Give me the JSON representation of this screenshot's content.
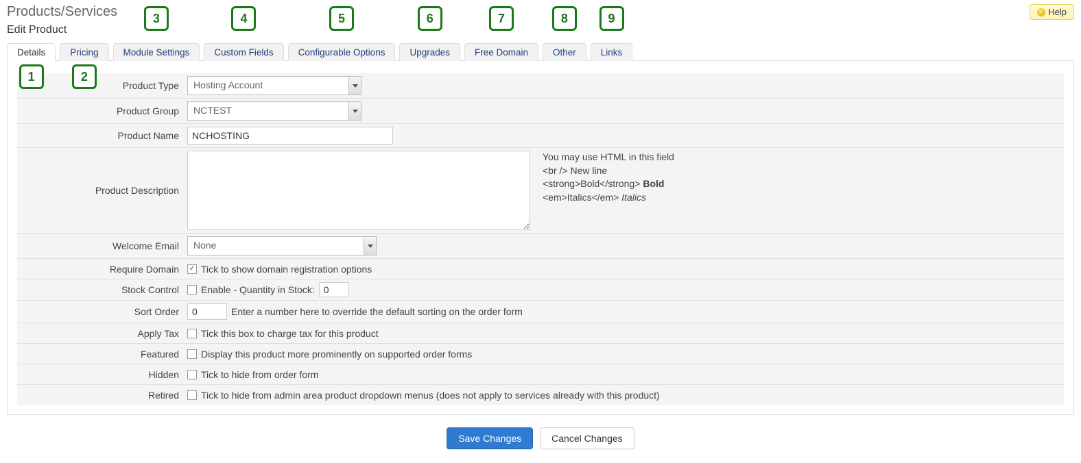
{
  "header": {
    "page_title": "Products/Services",
    "subtitle": "Edit Product",
    "help_label": "Help"
  },
  "tabs": [
    {
      "label": "Details",
      "badge": "1",
      "active": true,
      "badge_lower": true
    },
    {
      "label": "Pricing",
      "badge": "2",
      "badge_lower": true
    },
    {
      "label": "Module Settings",
      "badge": "3"
    },
    {
      "label": "Custom Fields",
      "badge": "4"
    },
    {
      "label": "Configurable Options",
      "badge": "5"
    },
    {
      "label": "Upgrades",
      "badge": "6"
    },
    {
      "label": "Free Domain",
      "badge": "7"
    },
    {
      "label": "Other",
      "badge": "8"
    },
    {
      "label": "Links",
      "badge": "9"
    }
  ],
  "form": {
    "product_type": {
      "label": "Product Type",
      "value": "Hosting Account"
    },
    "product_group": {
      "label": "Product Group",
      "value": "NCTEST"
    },
    "product_name": {
      "label": "Product Name",
      "value": "NCHOSTING"
    },
    "product_description": {
      "label": "Product Description",
      "value": "",
      "help_line1": "You may use HTML in this field",
      "help_line2a": "<br />",
      "help_line2b": "New line",
      "help_line3a": "<strong>Bold</strong>",
      "help_line3b": "Bold",
      "help_line4a": "<em>Italics</em>",
      "help_line4b": "Italics"
    },
    "welcome_email": {
      "label": "Welcome Email",
      "value": "None"
    },
    "require_domain": {
      "label": "Require Domain",
      "checked": true,
      "text": "Tick to show domain registration options"
    },
    "stock_control": {
      "label": "Stock Control",
      "checked": false,
      "text": "Enable - Quantity in Stock:",
      "qty": "0"
    },
    "sort_order": {
      "label": "Sort Order",
      "value": "0",
      "text": "Enter a number here to override the default sorting on the order form"
    },
    "apply_tax": {
      "label": "Apply Tax",
      "checked": false,
      "text": "Tick this box to charge tax for this product"
    },
    "featured": {
      "label": "Featured",
      "checked": false,
      "text": "Display this product more prominently on supported order forms"
    },
    "hidden": {
      "label": "Hidden",
      "checked": false,
      "text": "Tick to hide from order form"
    },
    "retired": {
      "label": "Retired",
      "checked": false,
      "text": "Tick to hide from admin area product dropdown menus (does not apply to services already with this product)"
    }
  },
  "footer": {
    "save": "Save Changes",
    "cancel": "Cancel Changes"
  }
}
